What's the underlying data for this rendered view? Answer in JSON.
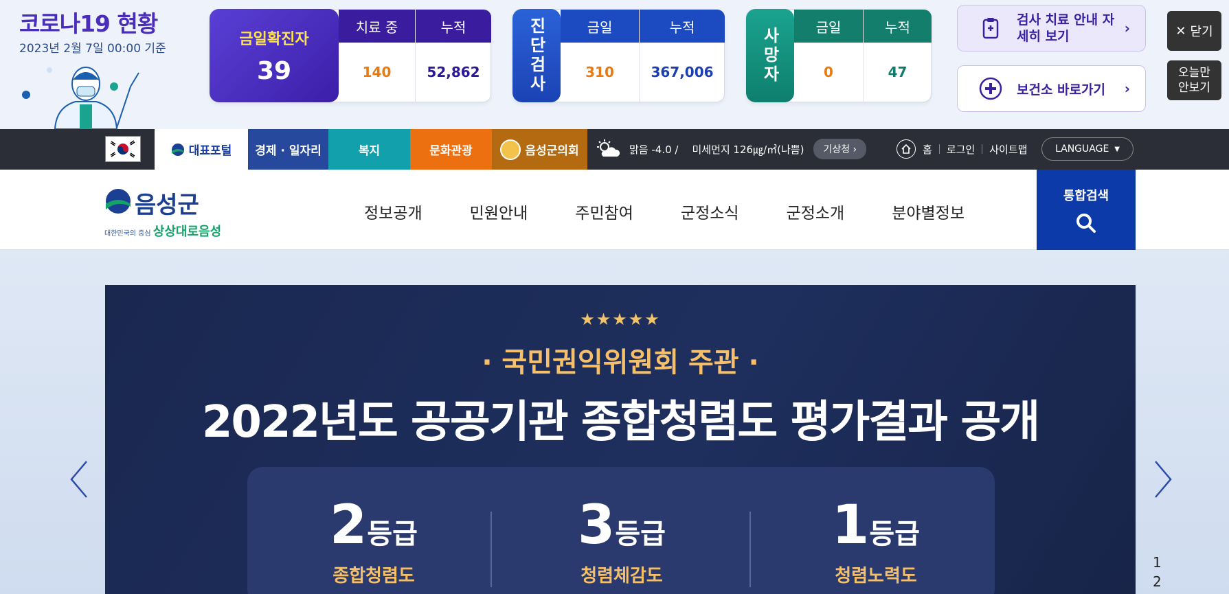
{
  "covid": {
    "title": "코로나19 현황",
    "date": "2023년 2월 7일 00:00 기준",
    "confirmed": {
      "label": "금일확진자",
      "value": "39",
      "h1": "치료 중",
      "h2": "누적",
      "v1": "140",
      "v2": "52,862"
    },
    "tests": {
      "label": "진단검사",
      "h1": "금일",
      "h2": "누적",
      "v1": "310",
      "v2": "367,006"
    },
    "deaths": {
      "label": "사망자",
      "h1": "금일",
      "h2": "누적",
      "v1": "0",
      "v2": "47"
    },
    "guide_button": "검사 치료 안내 자세히 보기",
    "health_center_button": "보건소 바로가기",
    "close_button": "닫기",
    "hide_today_button": "오늘만 안보기"
  },
  "topbar": {
    "tabs": [
      "대표포털",
      "경제 · 일자리",
      "복지",
      "문화관광",
      "음성군의회"
    ],
    "weather": "맑음 -4.0 /",
    "dust": "미세먼지 126㎍/㎥(나쁨)",
    "weather_link": "기상청 ›",
    "home": "홈",
    "login": "로그인",
    "sitemap": "사이트맵",
    "language": "LANGUAGE"
  },
  "nav": {
    "logo": "음성군",
    "slogan_small": "대한민국의 중심",
    "slogan": "상상대로음성",
    "menu": [
      "정보공개",
      "민원안내",
      "주민참여",
      "군정소식",
      "군정소개",
      "분야별정보"
    ],
    "search": "통합검색"
  },
  "hero": {
    "stars": "★★★★★",
    "subtitle": "· 국민권익위원회 주관 ·",
    "headline": "2022년도 공공기관 종합청렴도 평가결과 공개",
    "grades": [
      {
        "num": "2",
        "unit": "등급",
        "label": "종합청렴도"
      },
      {
        "num": "3",
        "unit": "등급",
        "label": "청렴체감도"
      },
      {
        "num": "1",
        "unit": "등급",
        "label": "청렴노력도"
      }
    ],
    "pager": [
      "1",
      "2"
    ]
  },
  "colors": {
    "covid_purple": "#3a1d9e",
    "tests_blue": "#1c4ac0",
    "deaths_teal": "#137e6c",
    "nav_search": "#0c3aa8"
  }
}
